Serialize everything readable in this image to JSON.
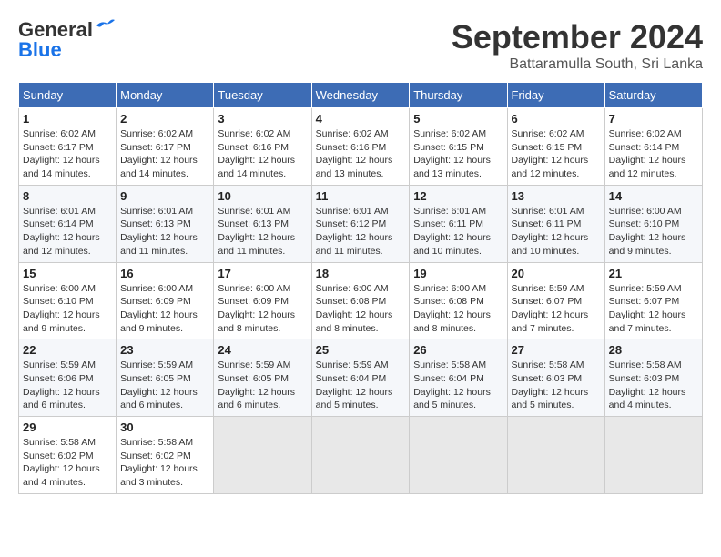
{
  "header": {
    "logo_general": "General",
    "logo_blue": "Blue",
    "month_title": "September 2024",
    "subtitle": "Battaramulla South, Sri Lanka"
  },
  "weekdays": [
    "Sunday",
    "Monday",
    "Tuesday",
    "Wednesday",
    "Thursday",
    "Friday",
    "Saturday"
  ],
  "weeks": [
    [
      {
        "day": "1",
        "sunrise": "6:02 AM",
        "sunset": "6:17 PM",
        "daylight": "12 hours and 14 minutes."
      },
      {
        "day": "2",
        "sunrise": "6:02 AM",
        "sunset": "6:17 PM",
        "daylight": "12 hours and 14 minutes."
      },
      {
        "day": "3",
        "sunrise": "6:02 AM",
        "sunset": "6:16 PM",
        "daylight": "12 hours and 14 minutes."
      },
      {
        "day": "4",
        "sunrise": "6:02 AM",
        "sunset": "6:16 PM",
        "daylight": "12 hours and 13 minutes."
      },
      {
        "day": "5",
        "sunrise": "6:02 AM",
        "sunset": "6:15 PM",
        "daylight": "12 hours and 13 minutes."
      },
      {
        "day": "6",
        "sunrise": "6:02 AM",
        "sunset": "6:15 PM",
        "daylight": "12 hours and 12 minutes."
      },
      {
        "day": "7",
        "sunrise": "6:02 AM",
        "sunset": "6:14 PM",
        "daylight": "12 hours and 12 minutes."
      }
    ],
    [
      {
        "day": "8",
        "sunrise": "6:01 AM",
        "sunset": "6:14 PM",
        "daylight": "12 hours and 12 minutes."
      },
      {
        "day": "9",
        "sunrise": "6:01 AM",
        "sunset": "6:13 PM",
        "daylight": "12 hours and 11 minutes."
      },
      {
        "day": "10",
        "sunrise": "6:01 AM",
        "sunset": "6:13 PM",
        "daylight": "12 hours and 11 minutes."
      },
      {
        "day": "11",
        "sunrise": "6:01 AM",
        "sunset": "6:12 PM",
        "daylight": "12 hours and 11 minutes."
      },
      {
        "day": "12",
        "sunrise": "6:01 AM",
        "sunset": "6:11 PM",
        "daylight": "12 hours and 10 minutes."
      },
      {
        "day": "13",
        "sunrise": "6:01 AM",
        "sunset": "6:11 PM",
        "daylight": "12 hours and 10 minutes."
      },
      {
        "day": "14",
        "sunrise": "6:00 AM",
        "sunset": "6:10 PM",
        "daylight": "12 hours and 9 minutes."
      }
    ],
    [
      {
        "day": "15",
        "sunrise": "6:00 AM",
        "sunset": "6:10 PM",
        "daylight": "12 hours and 9 minutes."
      },
      {
        "day": "16",
        "sunrise": "6:00 AM",
        "sunset": "6:09 PM",
        "daylight": "12 hours and 9 minutes."
      },
      {
        "day": "17",
        "sunrise": "6:00 AM",
        "sunset": "6:09 PM",
        "daylight": "12 hours and 8 minutes."
      },
      {
        "day": "18",
        "sunrise": "6:00 AM",
        "sunset": "6:08 PM",
        "daylight": "12 hours and 8 minutes."
      },
      {
        "day": "19",
        "sunrise": "6:00 AM",
        "sunset": "6:08 PM",
        "daylight": "12 hours and 8 minutes."
      },
      {
        "day": "20",
        "sunrise": "5:59 AM",
        "sunset": "6:07 PM",
        "daylight": "12 hours and 7 minutes."
      },
      {
        "day": "21",
        "sunrise": "5:59 AM",
        "sunset": "6:07 PM",
        "daylight": "12 hours and 7 minutes."
      }
    ],
    [
      {
        "day": "22",
        "sunrise": "5:59 AM",
        "sunset": "6:06 PM",
        "daylight": "12 hours and 6 minutes."
      },
      {
        "day": "23",
        "sunrise": "5:59 AM",
        "sunset": "6:05 PM",
        "daylight": "12 hours and 6 minutes."
      },
      {
        "day": "24",
        "sunrise": "5:59 AM",
        "sunset": "6:05 PM",
        "daylight": "12 hours and 6 minutes."
      },
      {
        "day": "25",
        "sunrise": "5:59 AM",
        "sunset": "6:04 PM",
        "daylight": "12 hours and 5 minutes."
      },
      {
        "day": "26",
        "sunrise": "5:58 AM",
        "sunset": "6:04 PM",
        "daylight": "12 hours and 5 minutes."
      },
      {
        "day": "27",
        "sunrise": "5:58 AM",
        "sunset": "6:03 PM",
        "daylight": "12 hours and 5 minutes."
      },
      {
        "day": "28",
        "sunrise": "5:58 AM",
        "sunset": "6:03 PM",
        "daylight": "12 hours and 4 minutes."
      }
    ],
    [
      {
        "day": "29",
        "sunrise": "5:58 AM",
        "sunset": "6:02 PM",
        "daylight": "12 hours and 4 minutes."
      },
      {
        "day": "30",
        "sunrise": "5:58 AM",
        "sunset": "6:02 PM",
        "daylight": "12 hours and 3 minutes."
      },
      null,
      null,
      null,
      null,
      null
    ]
  ]
}
